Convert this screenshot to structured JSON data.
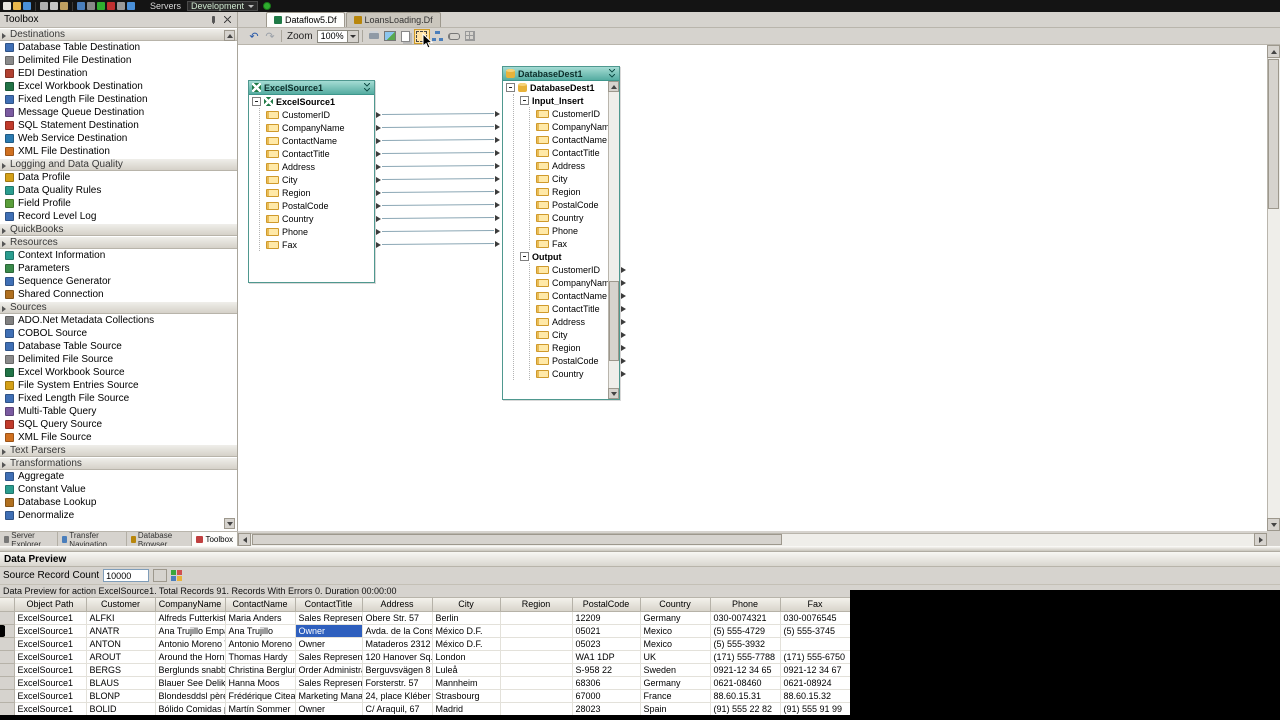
{
  "topbar": {
    "servers_label": "Servers",
    "environment_value": "Development",
    "icons": [
      {
        "name": "new-document-icon",
        "color": "#e8e6e0"
      },
      {
        "name": "open-folder-icon",
        "color": "#e8b64c"
      },
      {
        "name": "save-icon",
        "color": "#4a90d9"
      },
      {
        "name": "cut-icon",
        "color": "#b0b0b0"
      },
      {
        "name": "copy-icon",
        "color": "#c8c8c8"
      },
      {
        "name": "paste-icon",
        "color": "#c0a060"
      },
      {
        "name": "undo-icon",
        "color": "#4a7ebb"
      },
      {
        "name": "redo-icon",
        "color": "#888888"
      },
      {
        "name": "run-icon",
        "color": "#2fae2f"
      },
      {
        "name": "stop-icon",
        "color": "#c03030"
      },
      {
        "name": "settings-icon",
        "color": "#999999"
      },
      {
        "name": "help-icon",
        "color": "#4a90d9"
      }
    ]
  },
  "doc_tabs": [
    {
      "label": "Dataflow5.Df",
      "active": true
    },
    {
      "label": "LoansLoading.Df",
      "active": false
    }
  ],
  "toolbox": {
    "title": "Toolbox",
    "groups": [
      {
        "label": "Destinations",
        "items": [
          {
            "label": "Database Table Destination",
            "icon": "database-icon",
            "color": "#3f6fb5"
          },
          {
            "label": "Delimited File Destination",
            "icon": "file-icon",
            "color": "#8a8a8a"
          },
          {
            "label": "EDI Destination",
            "icon": "edi-icon",
            "color": "#b04030"
          },
          {
            "label": "Excel Workbook Destination",
            "icon": "excel-icon",
            "color": "#217346"
          },
          {
            "label": "Fixed Length File Destination",
            "icon": "file-icon",
            "color": "#3f6fb5"
          },
          {
            "label": "Message Queue Destination",
            "icon": "queue-icon",
            "color": "#7a5aa0"
          },
          {
            "label": "SQL Statement Destination",
            "icon": "sql-icon",
            "color": "#c03a2b"
          },
          {
            "label": "Web Service Destination",
            "icon": "webservice-icon",
            "color": "#2a7ab0"
          },
          {
            "label": "XML File Destination",
            "icon": "xml-icon",
            "color": "#d07020"
          }
        ]
      },
      {
        "label": "Logging and Data Quality",
        "items": [
          {
            "label": "Data Profile",
            "icon": "profile-icon",
            "color": "#d4a017"
          },
          {
            "label": "Data Quality Rules",
            "icon": "rules-icon",
            "color": "#2a9d8f"
          },
          {
            "label": "Field Profile",
            "icon": "field-profile-icon",
            "color": "#5a9e3a"
          },
          {
            "label": "Record Level Log",
            "icon": "log-icon",
            "color": "#3f6fb5"
          }
        ]
      },
      {
        "label": "QuickBooks",
        "items": []
      },
      {
        "label": "Resources",
        "items": [
          {
            "label": "Context Information",
            "icon": "info-icon",
            "color": "#2a9d8f"
          },
          {
            "label": "Parameters",
            "icon": "parameters-icon",
            "color": "#3a8a4a"
          },
          {
            "label": "Sequence Generator",
            "icon": "sequence-icon",
            "color": "#3f6fb5"
          },
          {
            "label": "Shared Connection",
            "icon": "connection-icon",
            "color": "#b07020"
          }
        ]
      },
      {
        "label": "Sources",
        "items": [
          {
            "label": "ADO.Net Metadata Collections",
            "icon": "metadata-icon",
            "color": "#808080"
          },
          {
            "label": "COBOL Source",
            "icon": "cobol-icon",
            "color": "#3f6fb5"
          },
          {
            "label": "Database Table Source",
            "icon": "database-icon",
            "color": "#3f6fb5"
          },
          {
            "label": "Delimited File Source",
            "icon": "file-icon",
            "color": "#8a8a8a"
          },
          {
            "label": "Excel Workbook Source",
            "icon": "excel-icon",
            "color": "#217346"
          },
          {
            "label": "File System Entries Source",
            "icon": "folder-icon",
            "color": "#d4a017"
          },
          {
            "label": "Fixed Length File Source",
            "icon": "file-icon",
            "color": "#3f6fb5"
          },
          {
            "label": "Multi-Table Query",
            "icon": "multitable-icon",
            "color": "#7a5aa0"
          },
          {
            "label": "SQL Query Source",
            "icon": "sql-icon",
            "color": "#c03a2b"
          },
          {
            "label": "XML File Source",
            "icon": "xml-icon",
            "color": "#d07020"
          }
        ]
      },
      {
        "label": "Text Parsers",
        "items": []
      },
      {
        "label": "Transformations",
        "items": [
          {
            "label": "Aggregate",
            "icon": "aggregate-icon",
            "color": "#3f6fb5"
          },
          {
            "label": "Constant Value",
            "icon": "constant-icon",
            "color": "#2a9d8f"
          },
          {
            "label": "Database Lookup",
            "icon": "lookup-icon",
            "color": "#b07020"
          },
          {
            "label": "Denormalize",
            "icon": "denormalize-icon",
            "color": "#3f6fb5"
          }
        ]
      }
    ]
  },
  "dock_tabs": [
    {
      "label": "Server Explorer",
      "active": false,
      "icon": "server-icon",
      "color": "#777777"
    },
    {
      "label": "Transfer Navigation",
      "active": false,
      "icon": "transfer-icon",
      "color": "#4a7ebb"
    },
    {
      "label": "Database Browser",
      "active": false,
      "icon": "database-icon",
      "color": "#b8860b"
    },
    {
      "label": "Toolbox",
      "active": true,
      "icon": "toolbox-icon",
      "color": "#c04040"
    }
  ],
  "canvas_toolbar": {
    "zoom_label": "Zoom",
    "zoom_value": "100%",
    "icons": [
      {
        "name": "undo-icon",
        "cls": "ci-undo"
      },
      {
        "name": "redo-icon",
        "cls": "ci-redo"
      },
      {
        "name": "print-icon",
        "cls": "ci-print"
      },
      {
        "name": "export-image-icon",
        "cls": "ci-picture"
      },
      {
        "name": "copy-diagram-icon",
        "cls": "ci-copydg"
      },
      {
        "name": "fit-view-icon",
        "cls": "ci-fit",
        "hovered": true
      },
      {
        "name": "auto-layout-icon",
        "cls": "ci-layout"
      },
      {
        "name": "link-mode-icon",
        "cls": "ci-link"
      },
      {
        "name": "overview-icon",
        "cls": "ci-grid"
      }
    ]
  },
  "diagram": {
    "excel_node": {
      "title": "ExcelSource1",
      "root_label": "ExcelSource1",
      "fields": [
        "CustomerID",
        "CompanyName",
        "ContactName",
        "ContactTitle",
        "Address",
        "City",
        "Region",
        "PostalCode",
        "Country",
        "Phone",
        "Fax"
      ]
    },
    "db_node": {
      "title": "DatabaseDest1",
      "root_label": "DatabaseDest1",
      "input_label": "Input_Insert",
      "input_fields": [
        "CustomerID",
        "CompanyName",
        "ContactName",
        "ContactTitle",
        "Address",
        "City",
        "Region",
        "PostalCode",
        "Country",
        "Phone",
        "Fax"
      ],
      "output_label": "Output",
      "output_fields": [
        "CustomerID",
        "CompanyName",
        "ContactName",
        "ContactTitle",
        "Address",
        "City",
        "Region",
        "PostalCode",
        "Country"
      ]
    }
  },
  "data_preview": {
    "title": "Data Preview",
    "record_count_label": "Source Record Count",
    "record_count_value": "10000",
    "status": "Data Preview for action ExcelSource1. Total Records 91. Records With Errors 0. Duration 00:00:00",
    "columns": [
      "Object Path",
      "Customer",
      "CompanyName",
      "ContactName",
      "ContactTitle",
      "Address",
      "City",
      "Region",
      "PostalCode",
      "Country",
      "Phone",
      "Fax"
    ],
    "selected_cell": {
      "row": 1,
      "col": 4
    },
    "current_row": 1,
    "rows": [
      [
        "ExcelSource1",
        "ALFKI",
        "Alfreds Futterkiste",
        "Maria Anders",
        "Sales Represent",
        "Obere Str. 57",
        "Berlin",
        "",
        "12209",
        "Germany",
        "030-0074321",
        "030-0076545"
      ],
      [
        "ExcelSource1",
        "ANATR",
        "Ana Trujillo Empa",
        "Ana Trujillo",
        "Owner",
        "Avda. de la Const",
        "México D.F.",
        "",
        "05021",
        "Mexico",
        "(5) 555-4729",
        "(5) 555-3745"
      ],
      [
        "ExcelSource1",
        "ANTON",
        "Antonio Moreno T",
        "Antonio Moreno",
        "Owner",
        "Mataderos 2312",
        "México D.F.",
        "",
        "05023",
        "Mexico",
        "(5) 555-3932",
        ""
      ],
      [
        "ExcelSource1",
        "AROUT",
        "Around the Horn",
        "Thomas Hardy",
        "Sales Represent",
        "120 Hanover Sq.",
        "London",
        "",
        "WA1 1DP",
        "UK",
        "(171) 555-7788",
        "(171) 555-6750"
      ],
      [
        "ExcelSource1",
        "BERGS",
        "Berglunds snabbk",
        "Christina Berglun",
        "Order Administrat",
        "Berguvsvägen 8",
        "Luleå",
        "",
        "S-958 22",
        "Sweden",
        "0921-12 34 65",
        "0921-12 34 67"
      ],
      [
        "ExcelSource1",
        "BLAUS",
        "Blauer See Delika",
        "Hanna Moos",
        "Sales Represent",
        "Forsterstr. 57",
        "Mannheim",
        "",
        "68306",
        "Germany",
        "0621-08460",
        "0621-08924"
      ],
      [
        "ExcelSource1",
        "BLONP",
        "Blondesddsl père",
        "Frédérique Citeau",
        "Marketing Manag",
        "24, place Kléber",
        "Strasbourg",
        "",
        "67000",
        "France",
        "88.60.15.31",
        "88.60.15.32"
      ],
      [
        "ExcelSource1",
        "BOLID",
        "Bólido Comidas p",
        "Martín Sommer",
        "Owner",
        "C/ Araquil, 67",
        "Madrid",
        "",
        "28023",
        "Spain",
        "(91) 555 22 82",
        "(91) 555 91 99"
      ]
    ]
  },
  "colors": {
    "node_header": "#55aca1",
    "selection": "#2e5fbe",
    "chrome": "#d6d3ce"
  }
}
